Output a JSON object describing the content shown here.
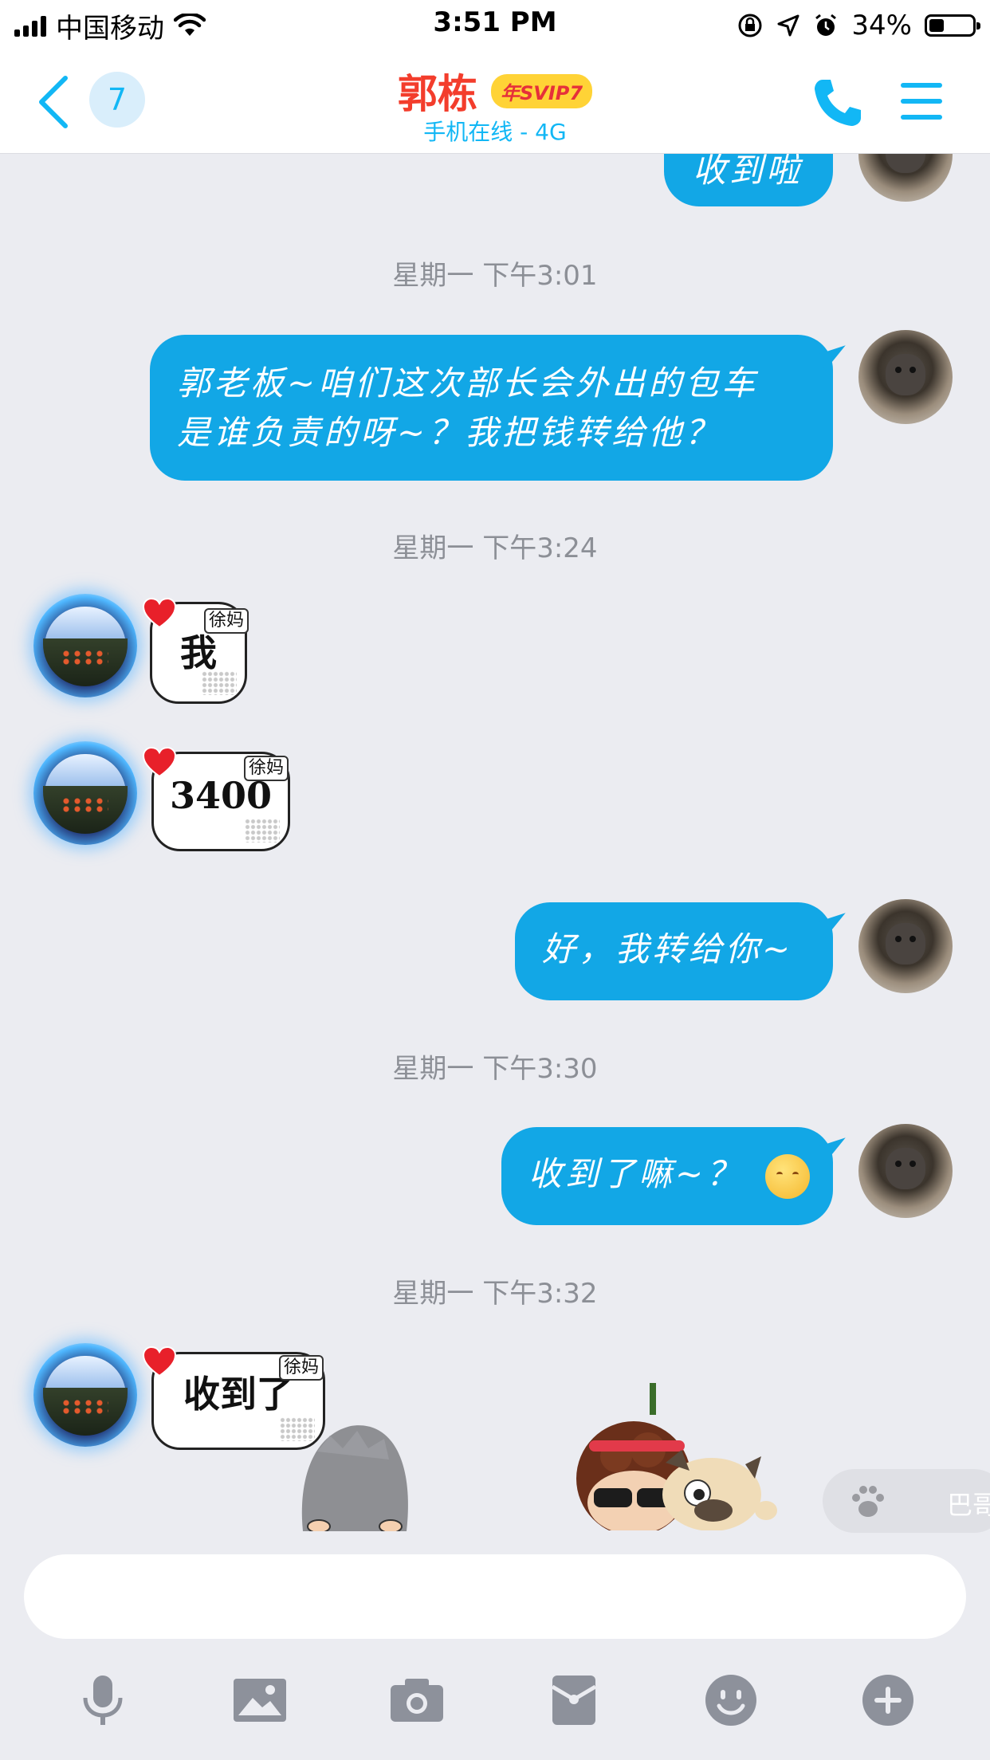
{
  "status_bar": {
    "carrier": "中国移动",
    "time": "3:51 PM",
    "battery_percent": "34%",
    "battery_level": 0.34
  },
  "header": {
    "unread_count": "7",
    "contact_name": "郭栋",
    "vip_badge": "年SVIP7",
    "online_status": "手机在线 - 4G"
  },
  "messages": {
    "partial_top": "收到啦",
    "ts1": "星期一 下午3:01",
    "msg1_line1": "郭老板~咱们这次部长会外出的包车",
    "msg1_line2": "是谁负责的呀~？我把钱转给他？",
    "ts2": "星期一 下午3:24",
    "msg2": "我",
    "msg2_tag": "徐妈",
    "msg3": "3400",
    "msg3_tag": "徐妈",
    "msg4": "好，我转给你~",
    "ts3": "星期一 下午3:30",
    "msg5": "收到了嘛~？",
    "ts4": "星期一 下午3:32",
    "msg6": "收到了",
    "msg6_tag": "徐妈"
  },
  "assistant_float": {
    "label": "巴哥"
  },
  "input": {
    "placeholder": ""
  },
  "colors": {
    "accent": "#12b7f5",
    "bubble": "#12a7e6",
    "name": "#f33d2c",
    "background": "#ebecf1"
  },
  "icons": [
    "back-icon",
    "phone-icon",
    "menu-icon",
    "microphone-icon",
    "image-icon",
    "camera-icon",
    "red-packet-icon",
    "emoji-icon",
    "plus-icon"
  ]
}
